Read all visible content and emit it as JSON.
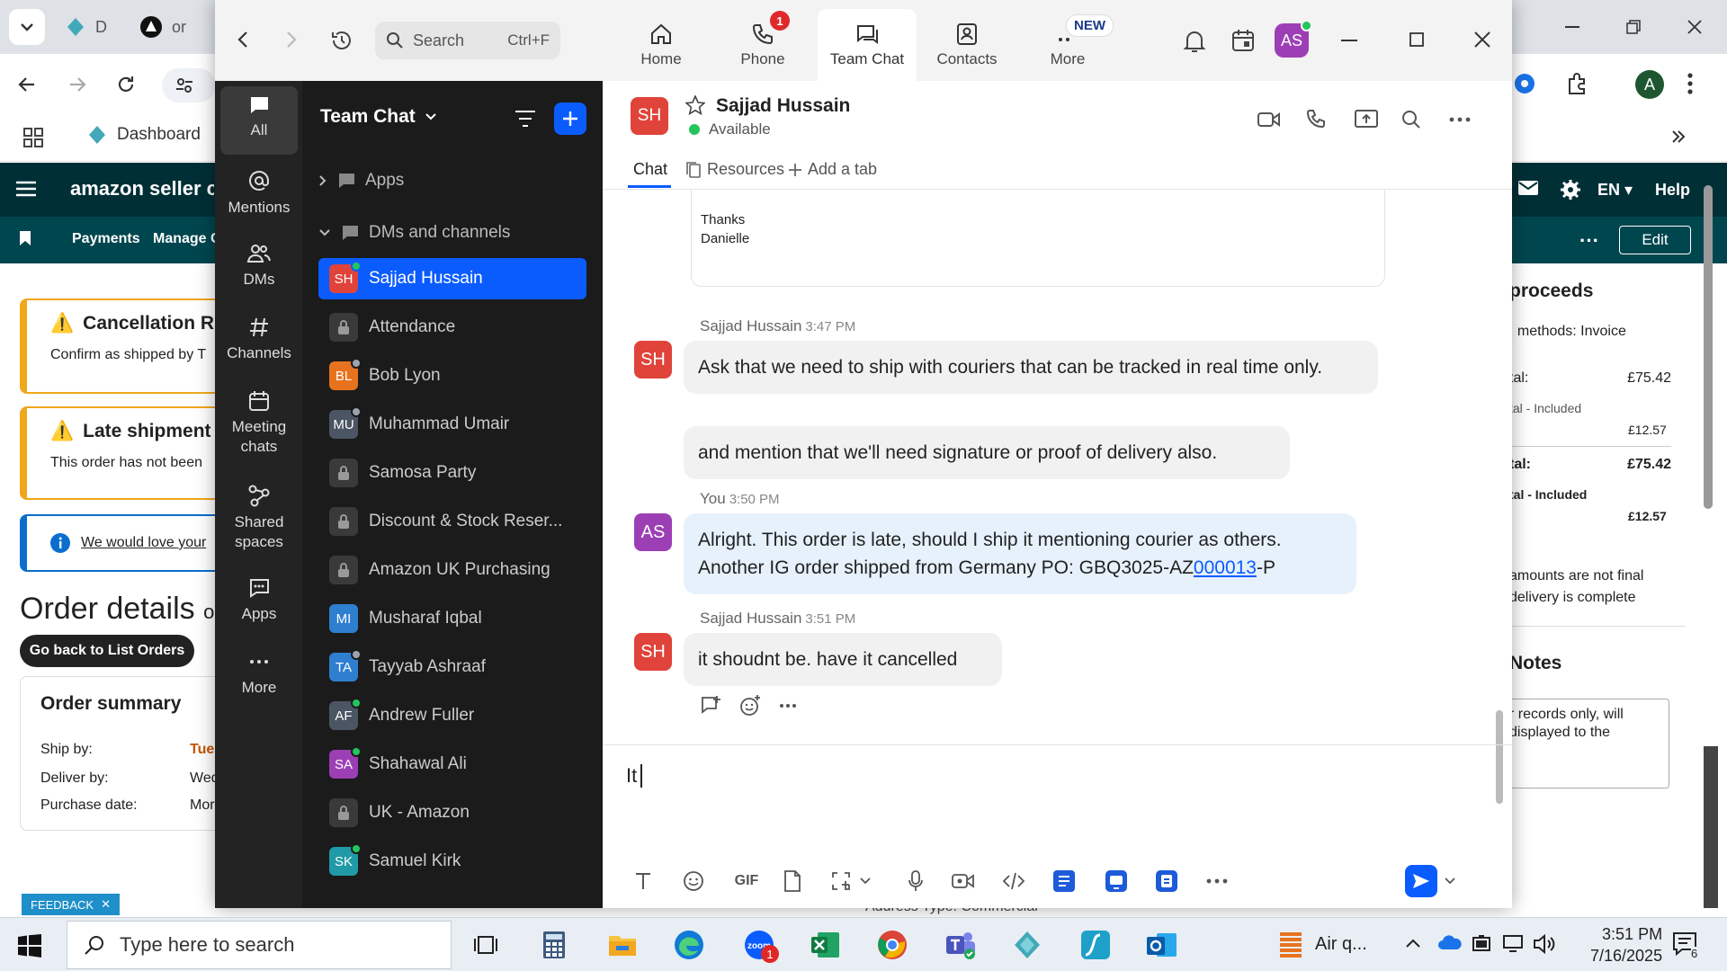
{
  "browser": {
    "tabs": [
      {
        "label": "D"
      },
      {
        "label": "or"
      }
    ],
    "bookmark": "Dashboard",
    "account_initial": "A",
    "amazon": {
      "logo": "amazon seller central",
      "lang": "EN",
      "help": "Help",
      "edit": "Edit",
      "nav": [
        "Payments",
        "Manage C"
      ],
      "alert1_title": "Cancellation Ri",
      "alert1_text": "Confirm as shipped by T",
      "alert2_title": "Late shipment",
      "alert2_text": "This order has not been",
      "info_text": "We would love your",
      "order_details": "Order details",
      "order_details_suffix": "o",
      "back_button": "Go back to List Orders",
      "summary_title": "Order summary",
      "ship_by": "Ship by:",
      "ship_by_val": "Tue",
      "deliver_by": "Deliver by:",
      "deliver_by_val": "Wed",
      "purchase_date": "Purchase date:",
      "purchase_date_val": "Mor",
      "feedback": "FEEDBACK",
      "address_type": "Address Type:  Commercial",
      "right": {
        "proceeds": "proceeds",
        "methods": ": methods: Invoice",
        "total1_label": "tal:",
        "total1_val": "£75.42",
        "incl1_label": "tal - Included",
        "incl1_val": "£12.57",
        "total2_label": "tal:",
        "total2_val": "£75.42",
        "incl2_label": "tal - Included",
        "incl2_val": "£12.57",
        "note1": "amounts are not final",
        "note2": " delivery is complete",
        "notes_title": "Notes",
        "notes1": "r records only, will",
        "notes2": "displayed to the"
      }
    }
  },
  "zoom": {
    "search_placeholder": "Search",
    "search_shortcut": "Ctrl+F",
    "nav": [
      {
        "label": "Home"
      },
      {
        "label": "Phone",
        "badge": "1"
      },
      {
        "label": "Team Chat"
      },
      {
        "label": "Contacts"
      },
      {
        "label": "More",
        "badge": "NEW"
      }
    ],
    "user_initials": "AS",
    "rail": [
      "All",
      "Mentions",
      "DMs",
      "Channels",
      "Meeting chats",
      "Shared spaces",
      "Apps",
      "More"
    ],
    "list_title": "Team Chat",
    "sections": {
      "apps": "Apps",
      "dms": "DMs and channels"
    },
    "channels": [
      {
        "name": "Sajjad Hussain",
        "initials": "SH",
        "color": "#e0433a",
        "status": "#22c55e",
        "active": true
      },
      {
        "name": "Attendance",
        "lock": true
      },
      {
        "name": "Bob Lyon",
        "initials": "BL",
        "color": "#e8731f",
        "status": "#9ca3af"
      },
      {
        "name": "Muhammad Umair",
        "initials": "MU",
        "color": "#4b5563",
        "status": "#9ca3af"
      },
      {
        "name": "Samosa Party",
        "lock": true
      },
      {
        "name": "Discount & Stock Reser...",
        "lock": true
      },
      {
        "name": "Amazon UK Purchasing",
        "lock": true
      },
      {
        "name": "Musharaf Iqbal",
        "initials": "MI",
        "color": "#2f7fd1"
      },
      {
        "name": "Tayyab Ashraaf",
        "initials": "TA",
        "color": "#2f7fd1",
        "status": "#9ca3af"
      },
      {
        "name": "Andrew Fuller",
        "initials": "AF",
        "color": "#4b5563",
        "status": "#22c55e"
      },
      {
        "name": "Shahawal Ali",
        "initials": "SA",
        "color": "#9c3fb5",
        "status": "#22c55e"
      },
      {
        "name": "UK - Amazon",
        "lock": true
      },
      {
        "name": "Samuel Kirk",
        "initials": "SK",
        "color": "#1f9aa6",
        "status": "#22c55e"
      }
    ],
    "chat": {
      "contact_initials": "SH",
      "contact_name": "Sajjad Hussain",
      "contact_status": "Available",
      "tabs": {
        "chat": "Chat",
        "resources": "Resources",
        "add": "Add a tab"
      },
      "quoted": [
        "Thanks",
        "Danielle"
      ],
      "messages": [
        {
          "sender": "Sajjad Hussain",
          "time": "3:47 PM",
          "bubbles": [
            "Ask that we need to ship with couriers that can be tracked in real time only.",
            "and mention that we'll need signature or proof of delivery also."
          ]
        },
        {
          "sender": "You",
          "time": "3:50 PM",
          "line1": "Alright. This order is late, should I ship it mentioning courier as others.",
          "line2_pre": "Another IG order shipped from Germany PO: GBQ3025-AZ",
          "line2_link": "000013",
          "line2_post": "-P"
        },
        {
          "sender": "Sajjad Hussain",
          "time": "3:51 PM",
          "bubbles": [
            "it shoudnt be. have it cancelled"
          ]
        }
      ],
      "composer_text": "It"
    }
  },
  "taskbar": {
    "search_placeholder": "Type here to search",
    "weather": "Air q...",
    "time": "3:51 PM",
    "date": "7/16/2025",
    "notif_count": "6",
    "zoom_badge": "1"
  }
}
